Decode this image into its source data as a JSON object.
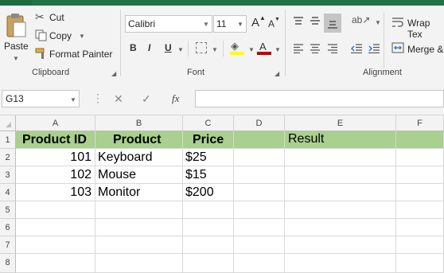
{
  "ribbon": {
    "clipboard": {
      "paste_label": "Paste",
      "cut_label": "Cut",
      "copy_label": "Copy",
      "format_painter_label": "Format Painter",
      "group_label": "Clipboard"
    },
    "font": {
      "font_name": "Calibri",
      "font_size": "11",
      "group_label": "Font",
      "bold": "B",
      "italic": "I",
      "underline": "U",
      "grow": "A",
      "shrink": "A",
      "font_color_letter": "A",
      "fill_color": "#ffff00",
      "text_color": "#c00000"
    },
    "alignment": {
      "wrap_text_label": "Wrap Tex",
      "merge_label": "Merge &",
      "group_label": "Alignment"
    }
  },
  "formula_bar": {
    "name_box": "G13",
    "fx_label": "fx",
    "cancel_glyph": "✕",
    "enter_glyph": "✓",
    "formula": ""
  },
  "sheet": {
    "columns": [
      "A",
      "B",
      "C",
      "D",
      "E",
      "F"
    ],
    "rows": [
      "1",
      "2",
      "3",
      "4",
      "5",
      "6",
      "7",
      "8"
    ],
    "header_fill": "#a9d08e",
    "cells": {
      "A1": "Product ID",
      "B1": "Product",
      "C1": "Price",
      "E1": "Result",
      "A2": "101",
      "B2": "Keyboard",
      "C2": "$25",
      "A3": "102",
      "B3": "Mouse",
      "C3": "$15",
      "A4": "103",
      "B4": "Monitor",
      "C4": "$200"
    }
  }
}
